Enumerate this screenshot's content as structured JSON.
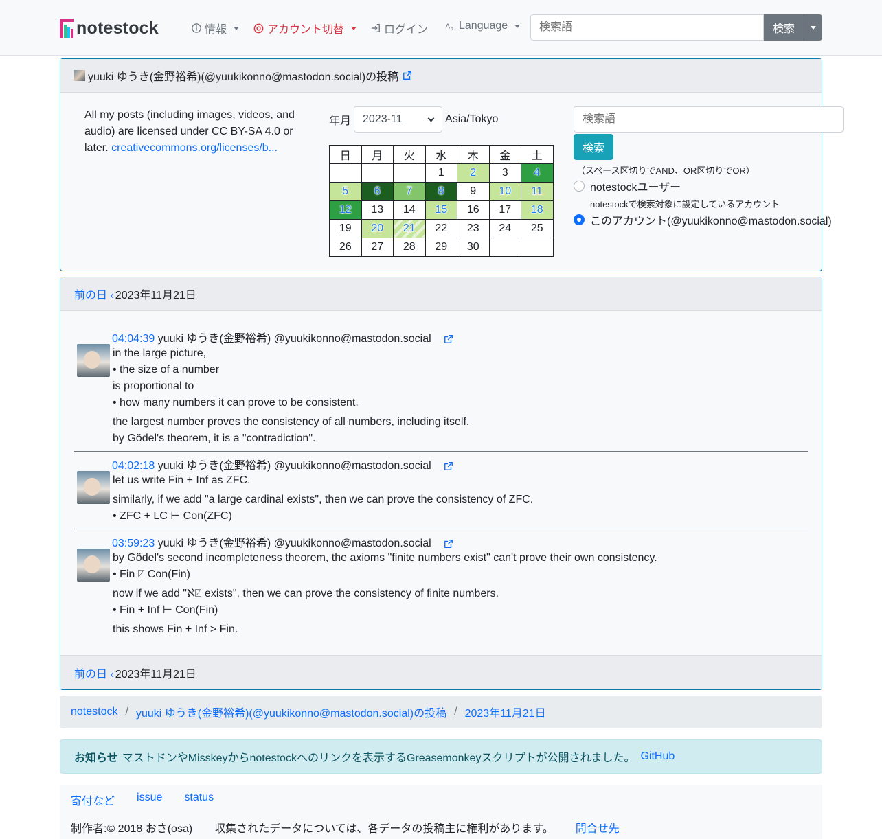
{
  "navbar": {
    "brand": "notestock",
    "info": "情報",
    "account_switch": "アカウント切替",
    "login": "ログイン",
    "language": "Language",
    "search_placeholder": "検索語",
    "search_button": "検索"
  },
  "account": {
    "title": "yuuki ゆうき(金野裕希)(@yuukikonno@mastodon.social)の投稿",
    "license_text": "All my posts (including images, videos, and audio) are licensed under CC BY-SA 4.0 or later. ",
    "license_link": "creativecommons.org/licenses/b..."
  },
  "calendar": {
    "ym_label": "年月",
    "ym_value": "2023-11",
    "timezone": "Asia/Tokyo",
    "weekdays": [
      "日",
      "月",
      "火",
      "水",
      "木",
      "金",
      "土"
    ],
    "weeks": [
      [
        "",
        "",
        "",
        "1",
        "2",
        "3",
        "4"
      ],
      [
        "5",
        "6",
        "7",
        "8",
        "9",
        "10",
        "11"
      ],
      [
        "12",
        "13",
        "14",
        "15",
        "16",
        "17",
        "18"
      ],
      [
        "19",
        "20",
        "21",
        "22",
        "23",
        "24",
        "25"
      ],
      [
        "26",
        "27",
        "28",
        "29",
        "30",
        "",
        ""
      ]
    ]
  },
  "sidesearch": {
    "placeholder": "検索語",
    "button": "検索",
    "hint": "（スペース区切りでAND、OR区切りでOR）",
    "opt_users": "notestockユーザー",
    "opt_users_help": "notestockで検索対象に設定しているアカウント",
    "opt_account": "このアカウント(@yuukikonno@mastodon.social)"
  },
  "day": {
    "prev": "前の日",
    "date": "2023年11月21日"
  },
  "posts": [
    {
      "time": "04:04:39",
      "author": "yuuki ゆうき(金野裕希) @yuukikonno@mastodon.social",
      "lines": [
        "in the large picture,",
        "• the size of a number",
        "is proportional to",
        "• how many numbers it can prove to be consistent."
      ],
      "lines2": [
        "the largest number proves the consistency of all numbers, including itself.",
        "by Gödel's theorem, it is a \"contradiction\"."
      ]
    },
    {
      "time": "04:02:18",
      "author": "yuuki ゆうき(金野裕希) @yuukikonno@mastodon.social",
      "lines": [
        "let us write Fin + Inf as ZFC."
      ],
      "lines2": [
        "similarly, if we add \"a large cardinal exists\", then we can prove the consistency of ZFC.",
        "• ZFC + LC ⊢ Con(ZFC)"
      ]
    },
    {
      "time": "03:59:23",
      "author": "yuuki ゆうき(金野裕希) @yuukikonno@mastodon.social",
      "lines": [
        "by Gödel's second incompleteness theorem, the axioms \"finite numbers exist\" can't prove their own consistency.",
        "• Fin ⍁ Con(Fin)"
      ],
      "lines2": [
        "now if we add \"ℵ⍁ exists\", then we can prove the consistency of finite numbers.",
        "• Fin + Inf ⊢ Con(Fin)"
      ],
      "lines3": [
        "this shows Fin + Inf > Fin."
      ]
    }
  ],
  "breadcrumb": [
    "notestock",
    "yuuki ゆうき(金野裕希)(@yuukikonno@mastodon.social)の投稿",
    "2023年11月21日"
  ],
  "alert": {
    "label": "お知らせ",
    "text": "マストドンやMisskeyからnotestockへのリンクを表示するGreasemonkeyスクリプトが公開されました。",
    "link": "GitHub"
  },
  "footer": {
    "links": [
      "寄付など",
      "issue",
      "status"
    ],
    "author": "制作者:© 2018 おさ(osa)",
    "rights": "収集されたデータについては、各データの投稿主に権利があります。",
    "contact": "問合せ先"
  }
}
